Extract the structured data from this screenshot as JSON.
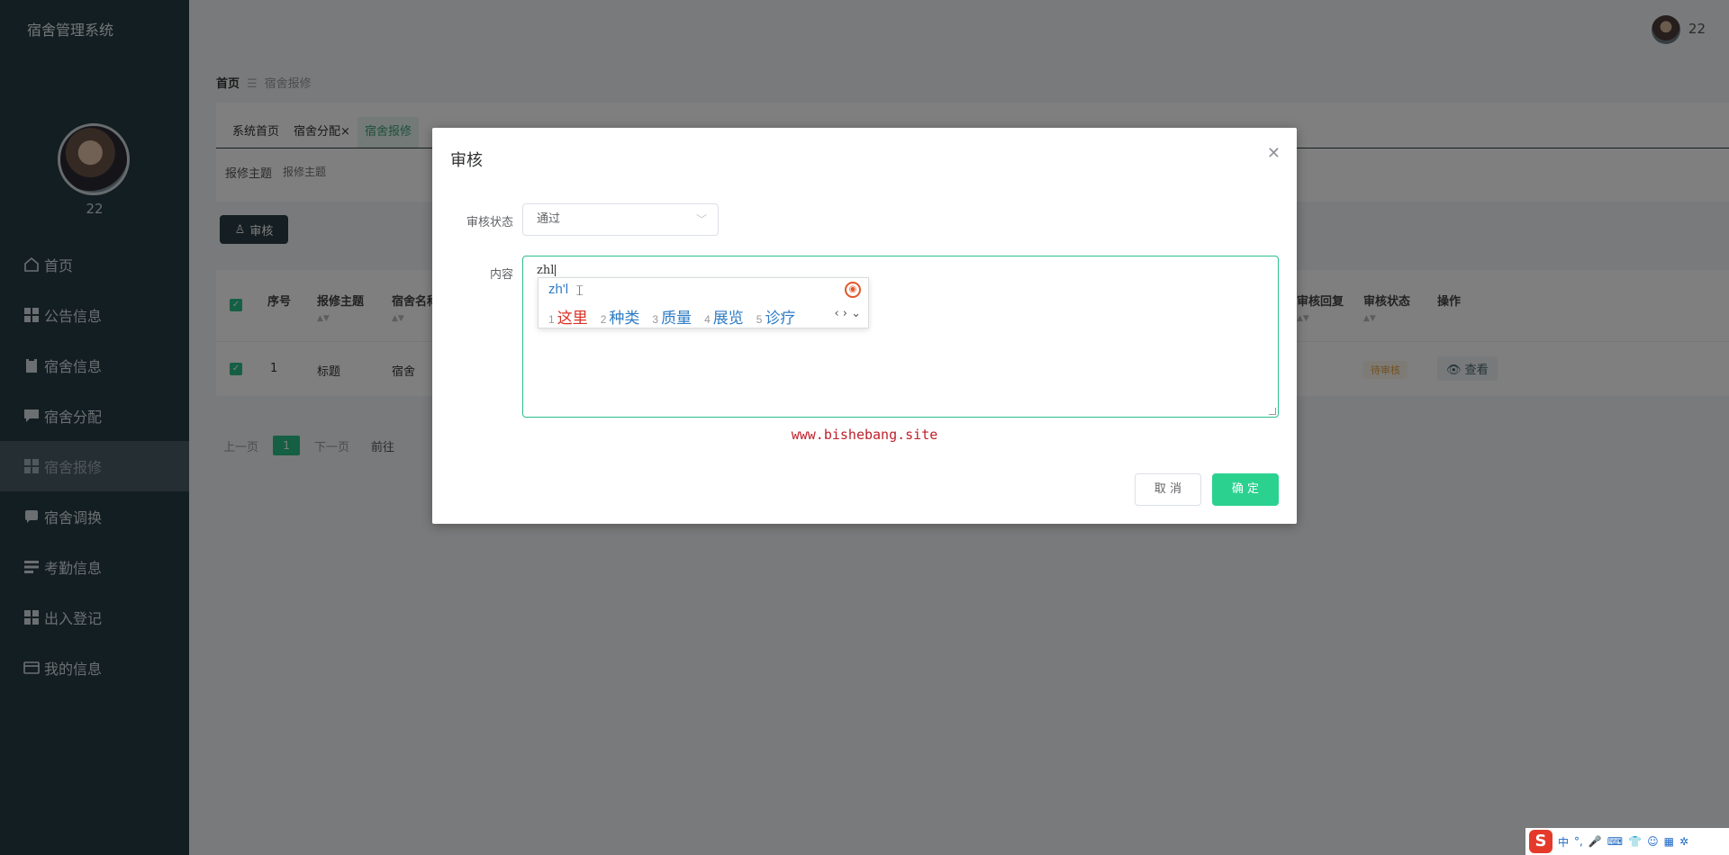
{
  "app": {
    "title": "宿舍管理系统",
    "user_name": "22"
  },
  "sidebar": {
    "items": [
      {
        "label": "首页",
        "icon": "home-icon"
      },
      {
        "label": "公告信息",
        "icon": "grid-icon"
      },
      {
        "label": "宿舍信息",
        "icon": "clipboard-icon"
      },
      {
        "label": "宿舍分配",
        "icon": "comment-icon"
      },
      {
        "label": "宿舍报修",
        "icon": "grid-icon",
        "active": true
      },
      {
        "label": "宿舍调换",
        "icon": "chat-icon"
      },
      {
        "label": "考勤信息",
        "icon": "list-icon"
      },
      {
        "label": "出入登记",
        "icon": "grid-icon"
      },
      {
        "label": "我的信息",
        "icon": "wallet-icon"
      }
    ]
  },
  "header": {
    "user_name": "22"
  },
  "breadcrumb": {
    "home": "首页",
    "current": "宿舍报修"
  },
  "tabs": [
    {
      "label": "系统首页"
    },
    {
      "label": "宿舍分配",
      "closable": true
    },
    {
      "label": "宿舍报修",
      "active": true
    }
  ],
  "search": {
    "label": "报修主题",
    "placeholder": "报修主题"
  },
  "toolbar": {
    "audit_label": "审核"
  },
  "table": {
    "headers": [
      "序号",
      "报修主题",
      "宿舍名称",
      "审核回复",
      "审核状态",
      "操作"
    ],
    "rows": [
      {
        "index": "1",
        "title": "标题",
        "dorm": "宿舍",
        "status": "待审核",
        "action": "查看"
      }
    ]
  },
  "pager": {
    "prev": "上一页",
    "current": "1",
    "next": "下一页",
    "goto": "前往"
  },
  "dialog": {
    "title": "审核",
    "status_label": "审核状态",
    "status_value": "通过",
    "content_label": "内容",
    "content_value": "zhl",
    "watermark": "www.bishebang.site",
    "cancel_label": "取 消",
    "confirm_label": "确 定"
  },
  "ime": {
    "pinyin": "zh'l",
    "candidates": [
      {
        "num": "1",
        "text": "这里"
      },
      {
        "num": "2",
        "text": "种类"
      },
      {
        "num": "3",
        "text": "质量"
      },
      {
        "num": "4",
        "text": "展览"
      },
      {
        "num": "5",
        "text": "诊疗"
      }
    ]
  },
  "tray": {
    "lang": "中",
    "punct": "°,"
  }
}
